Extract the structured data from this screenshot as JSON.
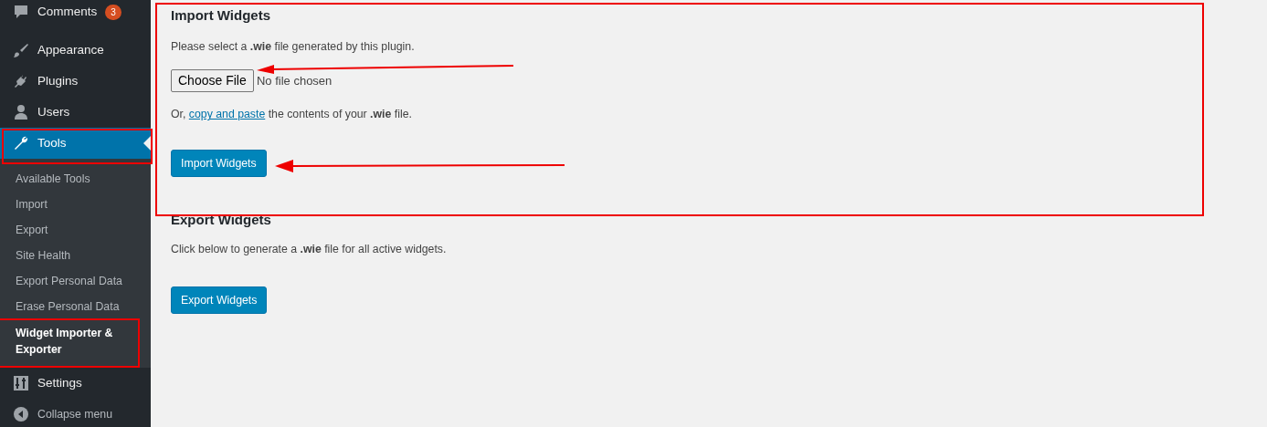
{
  "sidebar": {
    "items": [
      {
        "label": "Comments",
        "badge": "3",
        "selected": false
      },
      {
        "label": "Appearance",
        "selected": false
      },
      {
        "label": "Plugins",
        "selected": false
      },
      {
        "label": "Users",
        "selected": false
      },
      {
        "label": "Tools",
        "selected": true,
        "children": [
          {
            "label": "Available Tools",
            "selected": false
          },
          {
            "label": "Import",
            "selected": false
          },
          {
            "label": "Export",
            "selected": false
          },
          {
            "label": "Site Health",
            "selected": false
          },
          {
            "label": "Export Personal Data",
            "selected": false
          },
          {
            "label": "Erase Personal Data",
            "selected": false
          },
          {
            "label": "Widget Importer & Exporter",
            "selected": true
          }
        ]
      },
      {
        "label": "Settings",
        "selected": false
      }
    ],
    "collapse": "Collapse menu"
  },
  "import": {
    "title": "Import Widgets",
    "intro": "Please select a **.wie** file generated by this plugin.",
    "file_button": "Choose File",
    "file_status": "No file chosen",
    "alt_before": "Or, ",
    "alt_link": "copy and paste",
    "alt_after": " the contents of your **.wie** file.",
    "button": "Import Widgets"
  },
  "export": {
    "title": "Export Widgets",
    "intro": "Click below to generate a **.wie** file for all active widgets.",
    "button": "Export Widgets"
  }
}
